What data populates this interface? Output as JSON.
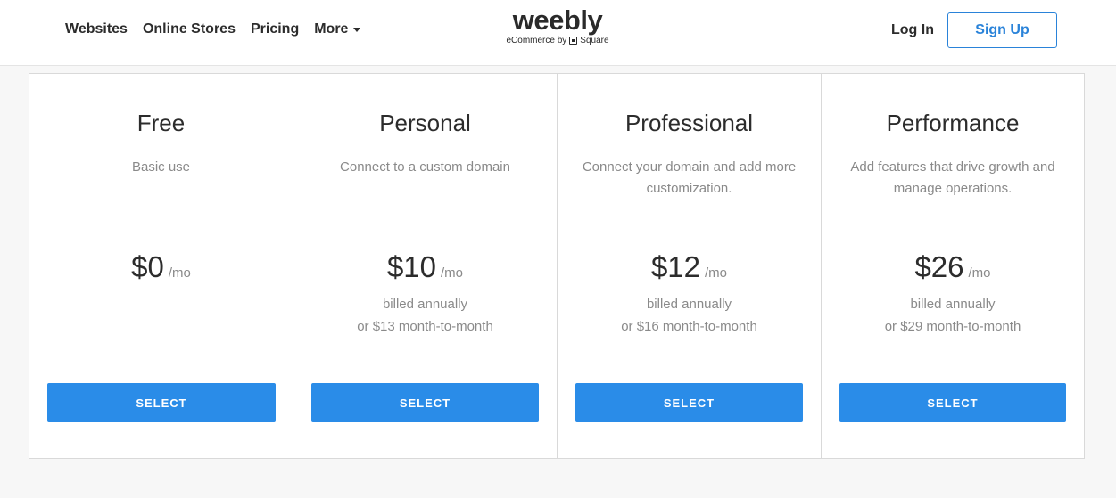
{
  "header": {
    "nav": [
      {
        "label": "Websites"
      },
      {
        "label": "Online Stores"
      },
      {
        "label": "Pricing"
      }
    ],
    "more_label": "More",
    "logo": {
      "word": "weebly",
      "sub_prefix": "eCommerce by",
      "sub_brand": "Square"
    },
    "login_label": "Log In",
    "signup_label": "Sign Up"
  },
  "plans": [
    {
      "name": "Free",
      "desc": "Basic use",
      "price": "$0",
      "per": "/mo",
      "billed": "",
      "monthly": "",
      "select_label": "SELECT"
    },
    {
      "name": "Personal",
      "desc": "Connect to a custom domain",
      "price": "$10",
      "per": "/mo",
      "billed": "billed annually",
      "monthly": "or $13 month-to-month",
      "select_label": "SELECT"
    },
    {
      "name": "Professional",
      "desc": "Connect your domain and add more customization.",
      "price": "$12",
      "per": "/mo",
      "billed": "billed annually",
      "monthly": "or $16 month-to-month",
      "select_label": "SELECT"
    },
    {
      "name": "Performance",
      "desc": "Add features that drive growth and manage operations.",
      "price": "$26",
      "per": "/mo",
      "billed": "billed annually",
      "monthly": "or $29 month-to-month",
      "select_label": "SELECT"
    }
  ],
  "colors": {
    "accent": "#2a8ce8",
    "text": "#2c2c2c",
    "muted": "#8a8a8a"
  }
}
